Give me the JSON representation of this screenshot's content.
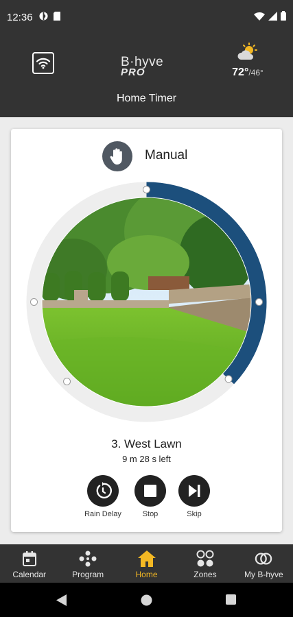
{
  "status_bar": {
    "time": "12:36",
    "icons": [
      "nfc-icon",
      "sim-icon",
      "wifi-icon",
      "signal-icon",
      "battery-icon"
    ]
  },
  "header": {
    "logo_top": "B·hyve",
    "logo_bottom": "PRO",
    "weather_temp": "72°",
    "weather_low": "/46°",
    "weather_icon": "partly-cloudy-icon",
    "title": "Home Timer"
  },
  "card": {
    "mode_label": "Manual",
    "mode_icon": "hand-icon",
    "zone_name": "3. West Lawn",
    "time_left": "9 m 28 s left",
    "progress_fraction": 0.37,
    "actions": [
      {
        "label": "Rain Delay",
        "icon": "rain-delay-icon"
      },
      {
        "label": "Stop",
        "icon": "stop-icon"
      },
      {
        "label": "Skip",
        "icon": "skip-icon"
      }
    ]
  },
  "bottom_nav": {
    "items": [
      {
        "label": "Calendar",
        "icon": "calendar-icon"
      },
      {
        "label": "Program",
        "icon": "program-icon"
      },
      {
        "label": "Home",
        "icon": "home-icon",
        "active": true
      },
      {
        "label": "Zones",
        "icon": "zones-icon"
      },
      {
        "label": "My B-hyve",
        "icon": "my-bhyve-icon"
      }
    ]
  },
  "colors": {
    "header_bg": "#333333",
    "accent": "#f3b824",
    "progress": "#1c4f7c",
    "ring": "#eeeeee"
  }
}
